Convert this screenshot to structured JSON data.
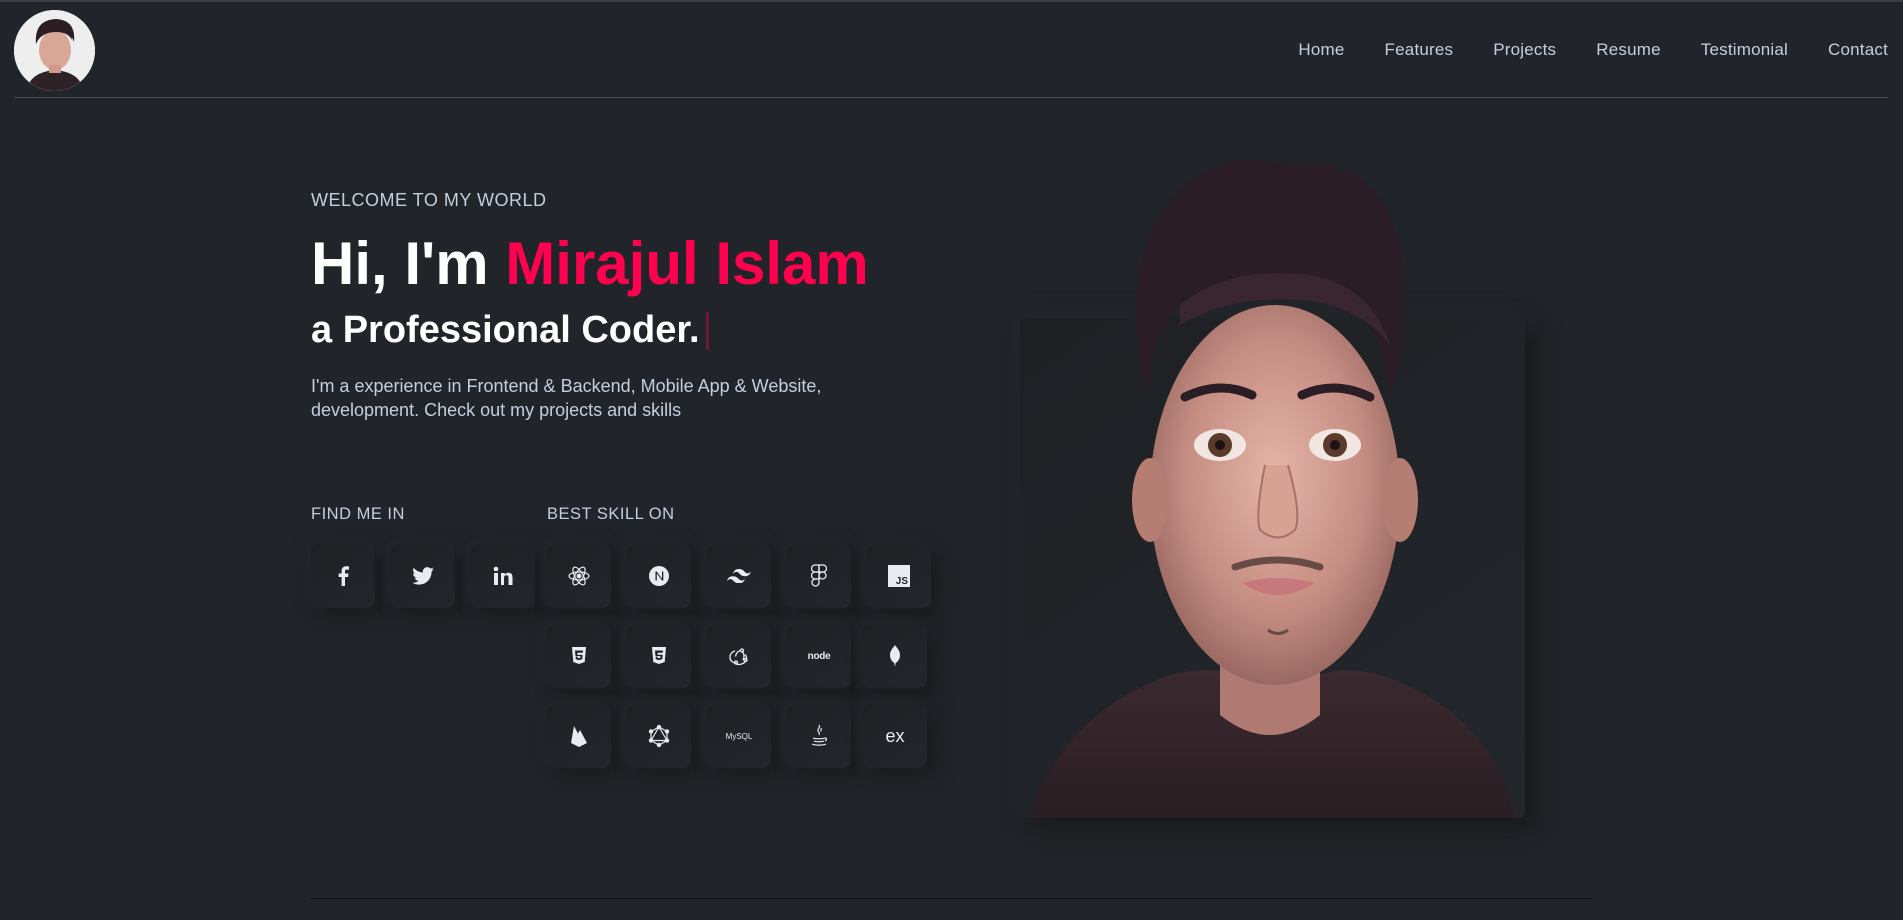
{
  "nav": {
    "items": [
      "Home",
      "Features",
      "Projects",
      "Resume",
      "Testimonial",
      "Contact"
    ]
  },
  "hero": {
    "welcome": "WELCOME TO MY WORLD",
    "greeting": "Hi, I'm ",
    "name": "Mirajul Islam",
    "subtitle": "a Professional Coder.",
    "description": "I'm a experience in Frontend & Backend, Mobile App & Website, development. Check out my projects and skills"
  },
  "social": {
    "label": "FIND ME IN",
    "icons": [
      "facebook-icon",
      "twitter-icon",
      "linkedin-icon"
    ]
  },
  "skills": {
    "label": "BEST SKILL ON",
    "icons": [
      "react-icon",
      "nextjs-icon",
      "tailwind-icon",
      "figma-icon",
      "javascript-icon",
      "html5-icon",
      "css3-icon",
      "redux-icon",
      "nodejs-icon",
      "mongodb-icon",
      "firebase-icon",
      "graphql-icon",
      "mysql-icon",
      "java-icon",
      "express-icon"
    ],
    "text_marks": {
      "js": "JS",
      "node": "node",
      "mysql": "MySQL",
      "express": "ex"
    }
  },
  "colors": {
    "background": "#212428",
    "accent": "#ff014f",
    "text": "#c4cfde",
    "heading": "#ffffff"
  }
}
